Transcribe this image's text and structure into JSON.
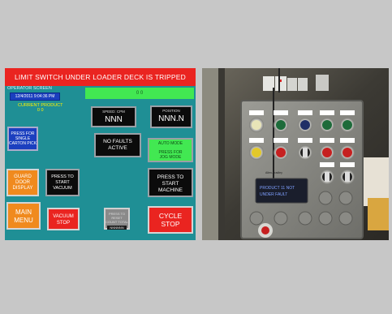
{
  "hmi": {
    "alarm_banner": "LIMIT SWITCH UNDER LOADER DECK IS TRIPPED",
    "operator_screen_label": "OPERATOR SCREEN",
    "datetime": "12/4/2011 9:04:36 PM",
    "current_product_label": "CURRENT PRODUCT",
    "current_product_value": "0   0",
    "status_bar_value": "0   0",
    "speed_label": "SPEED: CPM",
    "speed_value": "NNN",
    "position_label": "POSITION",
    "position_value": "NNN.N",
    "no_faults_line1": "NO FAULTS",
    "no_faults_line2": "ACTIVE",
    "auto_mode_line1": "AUTO MODE",
    "auto_mode_line2": "PRESS FOR",
    "auto_mode_line3": "JOG MODE",
    "single_carton_line1": "PRESS FOR",
    "single_carton_line2": "SINGLE",
    "single_carton_line3": "CARTON PICK",
    "guard_door_line1": "GUARD",
    "guard_door_line2": "DOOR",
    "guard_door_line3": "DISPLAY",
    "start_vacuum_line1": "PRESS TO",
    "start_vacuum_line2": "START",
    "start_vacuum_line3": "VACUUM",
    "start_machine_line1": "PRESS TO",
    "start_machine_line2": "START",
    "start_machine_line3": "MACHINE",
    "main_menu_line1": "MAIN",
    "main_menu_line2": "MENU",
    "vacuum_stop_line1": "VACUUM",
    "vacuum_stop_line2": "STOP",
    "counter_line1": "PRESS TO RESET",
    "counter_line2": "COUNT TOTAL",
    "counter_value": "NNNNNN",
    "cycle_stop_line1": "CYCLE",
    "cycle_stop_line2": "STOP"
  },
  "photo": {
    "display_line1": "PRODUCT 11 NOT",
    "display_line2": "UNDER FAULT",
    "plate_text": "Allen-Bradley"
  },
  "colors": {
    "background": "#c7c7c7",
    "hmi_teal": "#1f8f95",
    "alarm_red": "#ea2420",
    "status_green": "#42e852",
    "button_orange": "#f08a1e",
    "button_blue": "#1b3fbf"
  }
}
